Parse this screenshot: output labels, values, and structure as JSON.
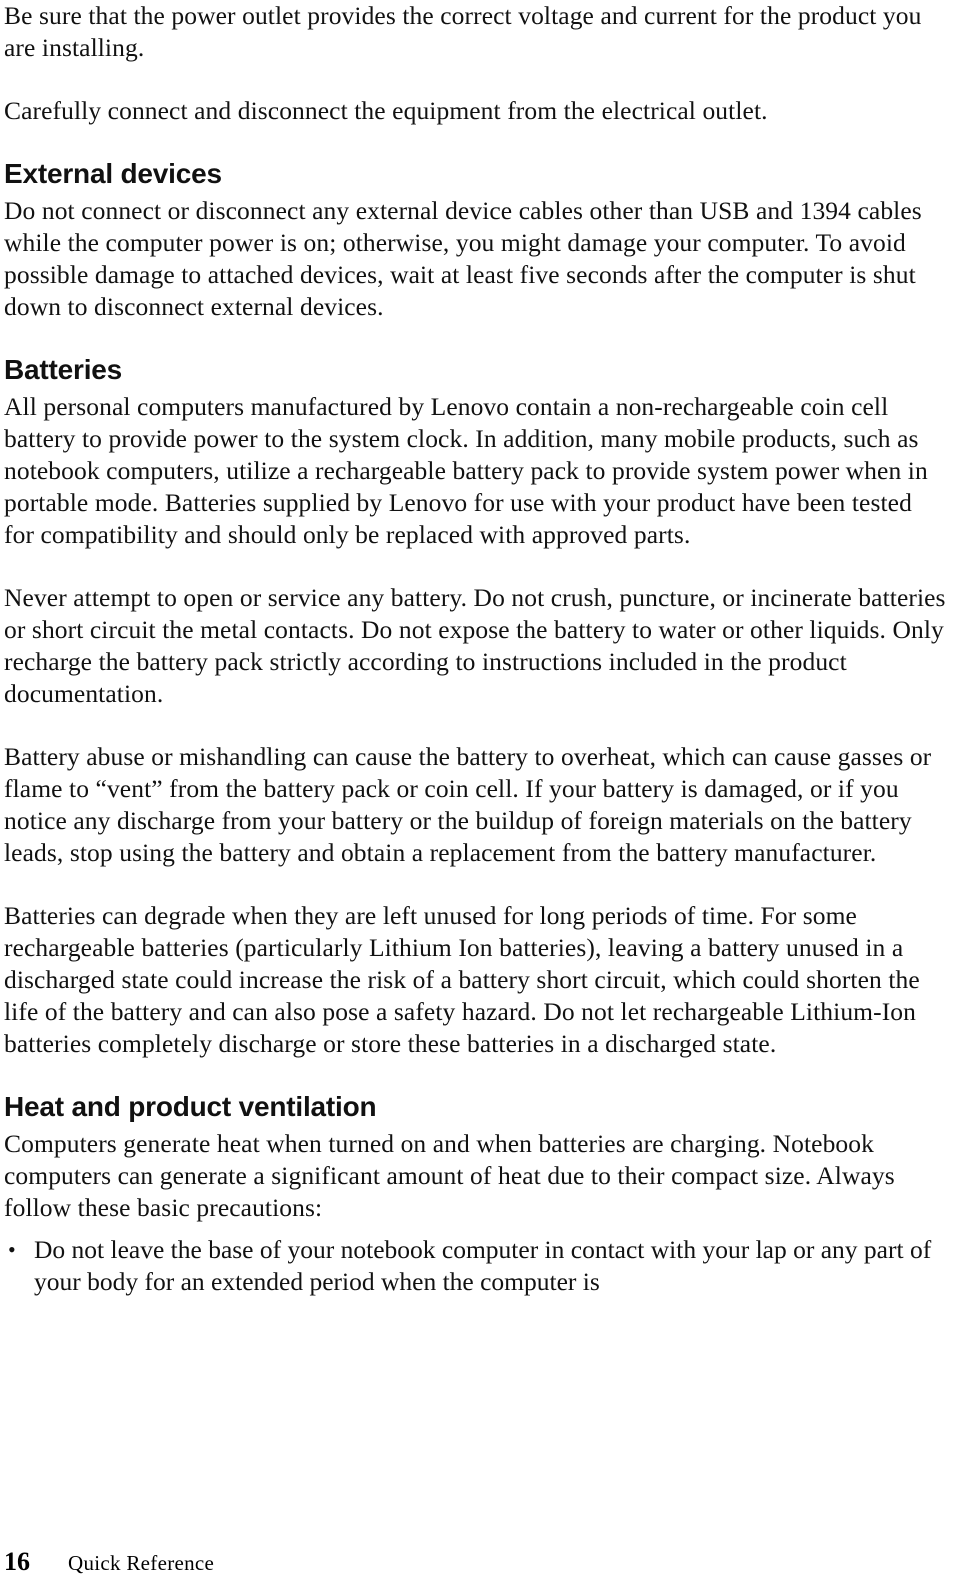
{
  "document": {
    "page_number": "16",
    "footer_title": "Quick Reference"
  },
  "blocks": [
    {
      "type": "paragraph",
      "name": "paragraph-power-outlet",
      "text": "Be sure that the power outlet provides the correct voltage and current for the product you are installing."
    },
    {
      "type": "paragraph",
      "name": "paragraph-connect-disconnect",
      "text": "Carefully connect and disconnect the equipment from the electrical outlet."
    },
    {
      "type": "heading",
      "name": "heading-external-devices",
      "text": "External devices"
    },
    {
      "type": "paragraph",
      "name": "paragraph-external-devices",
      "text": "Do not connect or disconnect any external device cables other than USB and 1394 cables while the computer power is on; otherwise, you might damage your computer. To avoid possible damage to attached devices, wait at least five seconds after the computer is shut down to disconnect external devices."
    },
    {
      "type": "heading",
      "name": "heading-batteries",
      "text": "Batteries"
    },
    {
      "type": "paragraph",
      "name": "paragraph-batteries-intro",
      "text": "All personal computers manufactured by Lenovo contain a non-rechargeable coin cell battery to provide power to the system clock. In addition, many mobile products, such as notebook computers, utilize a rechargeable battery pack to provide system power when in portable mode. Batteries supplied by Lenovo for use with your product have been tested for compatibility and should only be replaced with approved parts."
    },
    {
      "type": "paragraph",
      "name": "paragraph-battery-service-warning",
      "text": "Never attempt to open or service any battery. Do not crush, puncture, or incinerate batteries or short circuit the metal contacts. Do not expose the battery to water or other liquids. Only recharge the battery pack strictly according to instructions included in the product documentation."
    },
    {
      "type": "paragraph",
      "name": "paragraph-battery-abuse",
      "text": "Battery abuse or mishandling can cause the battery to overheat, which can cause gasses or flame to “vent” from the battery pack or coin cell. If your battery is damaged, or if you notice any discharge from your battery or the buildup of foreign materials on the battery leads, stop using the battery and obtain a replacement from the battery manufacturer."
    },
    {
      "type": "paragraph",
      "name": "paragraph-battery-degrade",
      "text": "Batteries can degrade when they are left unused for long periods of time. For some rechargeable batteries (particularly Lithium Ion batteries), leaving a battery unused in a discharged state could increase the risk of a battery short circuit, which could shorten the life of the battery and can also pose a safety hazard. Do not let rechargeable Lithium-Ion batteries completely discharge or store these batteries in a discharged state."
    },
    {
      "type": "heading",
      "name": "heading-heat-and-product-ventilation",
      "text": "Heat and product ventilation"
    },
    {
      "type": "paragraph",
      "name": "paragraph-heat-intro",
      "text": "Computers generate heat when turned on and when batteries are charging. Notebook computers can generate a significant amount of heat due to their compact size. Always follow these basic precautions:"
    },
    {
      "type": "list",
      "name": "list-heat-precautions",
      "bullet_glyph": "•",
      "items": [
        "Do not leave the base of your notebook computer in contact with your lap or any part of your body for an extended period when the computer is"
      ]
    }
  ]
}
